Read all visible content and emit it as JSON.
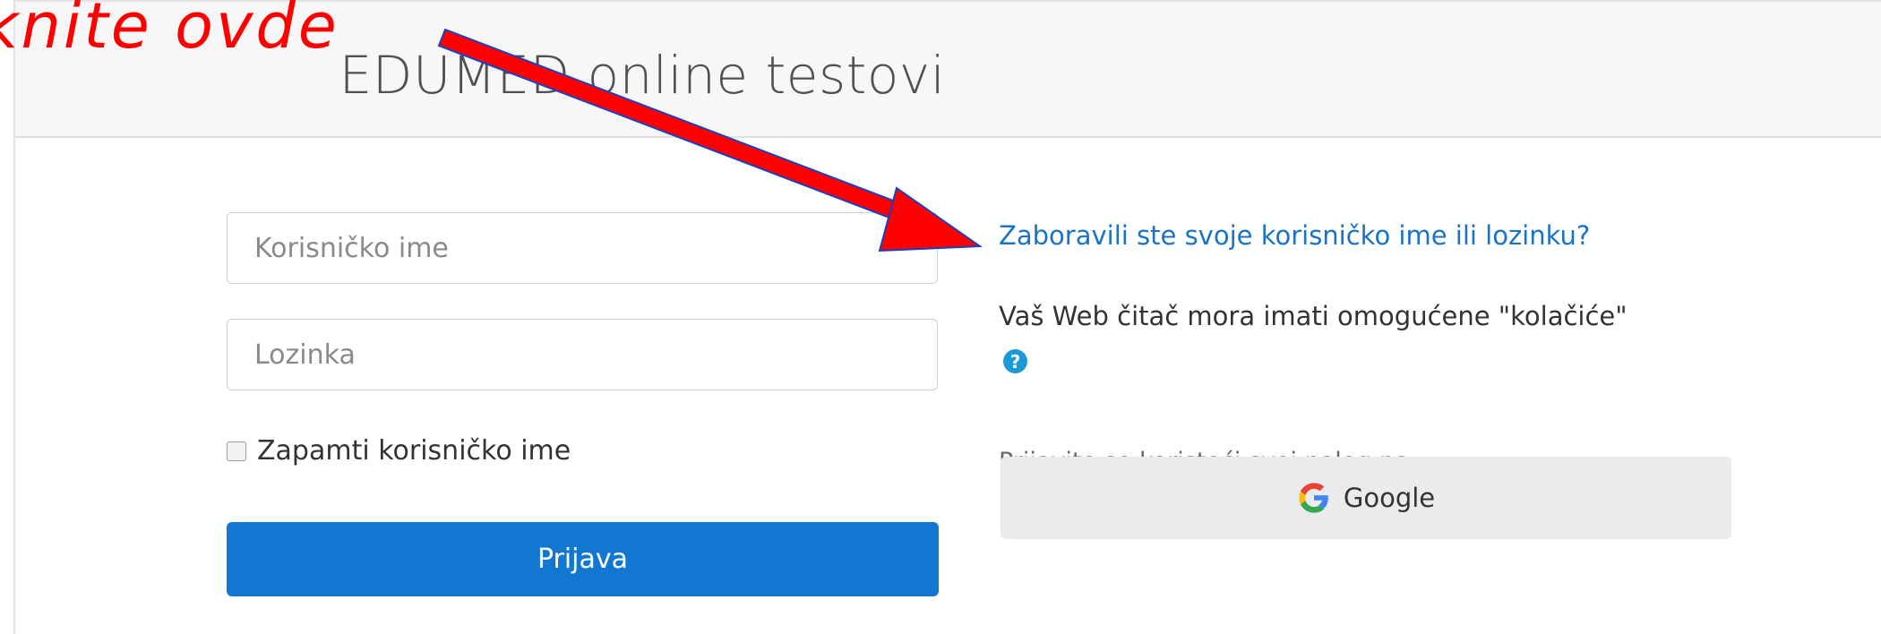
{
  "header": {
    "title": "EDUMED online testovi"
  },
  "login_form": {
    "username_placeholder": "Korisničko ime",
    "password_placeholder": "Lozinka",
    "remember_label": "Zapamti korisničko ime",
    "remember_checked": false,
    "submit_label": "Prijava"
  },
  "side_panel": {
    "forgot_link": "Zaboravili ste svoje korisničko ime ili lozinku?",
    "cookies_notice": "Vaš Web čitač mora imati omogućene \"kolačiće\"",
    "help_icon": "question-circle-icon",
    "oauth_label": "Prijavite se koristeći svoj nalog na:",
    "google_button": "Google"
  },
  "annotation": {
    "text": "knite ovde",
    "color": "#ff0000"
  },
  "colors": {
    "primary": "#1177d1",
    "link": "#1a73c4",
    "header_bg": "#f7f7f7",
    "google_btn_bg": "#e9ebed"
  }
}
